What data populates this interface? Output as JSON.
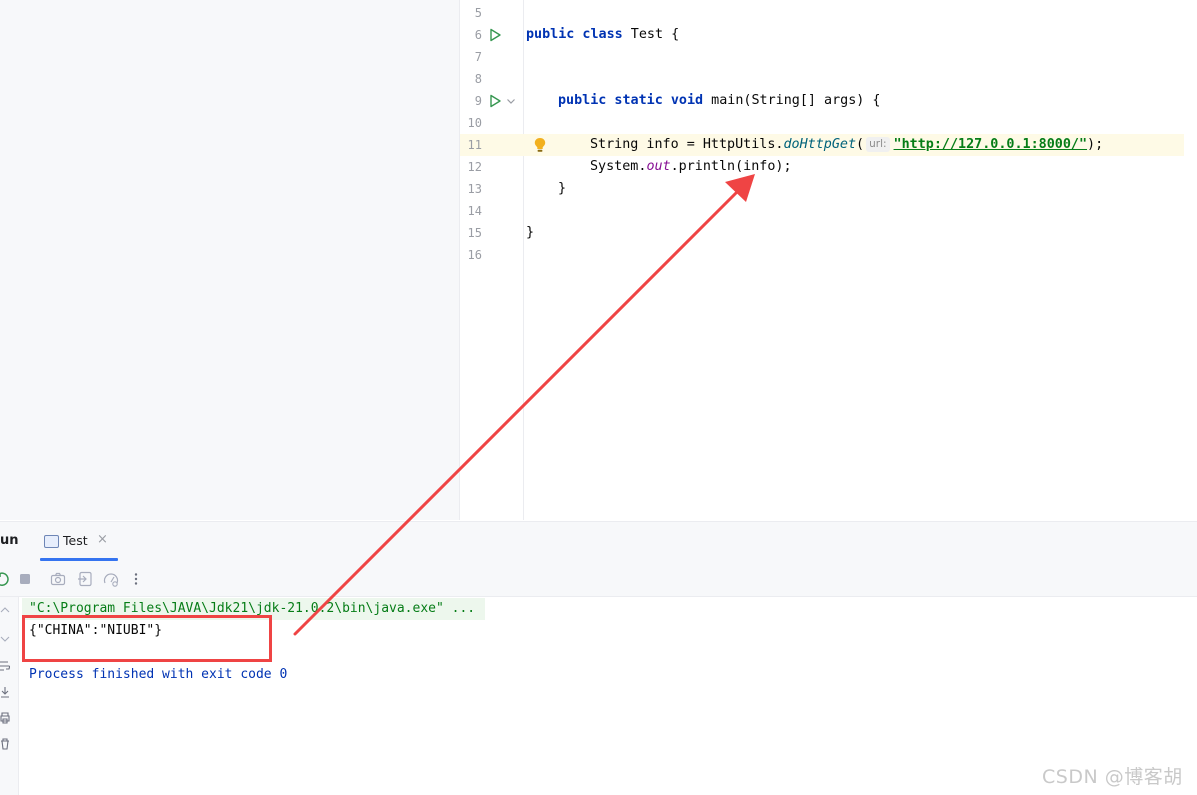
{
  "editor": {
    "line_numbers": [
      "5",
      "6",
      "7",
      "8",
      "9",
      "10",
      "11",
      "12",
      "13",
      "14",
      "15",
      "16"
    ],
    "code": {
      "class_kw": "public class",
      "class_name": " Test {",
      "main_kw": "public static void",
      "main_sig": " main(String[] args) {",
      "l11_pre": "String info = HttpUtils.",
      "l11_method": "doHttpGet",
      "l11_paren": "(",
      "l11_hint": "url:",
      "l11_string": "\"http://127.0.0.1:8000/\"",
      "l11_end": ");",
      "l12_pre": "System.",
      "l12_field": "out",
      "l12_post": ".println(info);",
      "l13": "}",
      "l15": "}"
    }
  },
  "tool_window": {
    "title": "un",
    "tab_label": "Test",
    "tab_close": "×"
  },
  "console": {
    "command": "\"C:\\Program Files\\JAVA\\Jdk21\\jdk-21.0.2\\bin\\java.exe\" ...",
    "output": "{\"CHINA\":\"NIUBI\"}",
    "exit": "Process finished with exit code 0"
  },
  "icons": {
    "run": "run-gutter-icon",
    "bulb": "lightbulb-icon",
    "stop": "stop-icon",
    "camera": "camera-icon",
    "restore": "restore-layout-icon",
    "dump": "thread-dump-icon",
    "more": "more-vertical-icon"
  },
  "colors": {
    "annotation": "#ef4444",
    "keyword": "#0033b3",
    "string": "#067d17"
  },
  "watermark": "CSDN @博客胡"
}
